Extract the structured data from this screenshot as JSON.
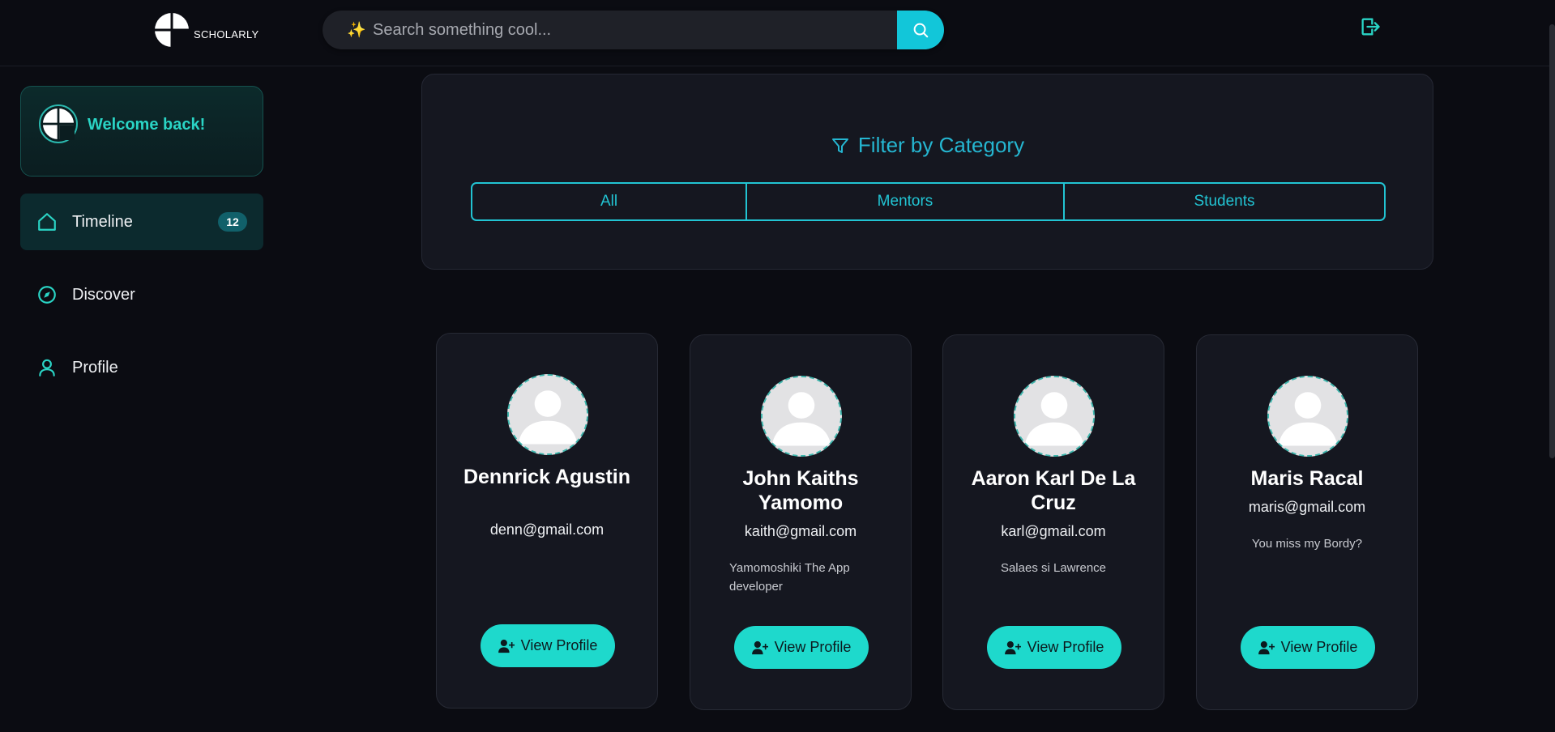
{
  "header": {
    "logo_text": "SCHOLARLY",
    "search_placeholder": "Search something cool...",
    "search_icon": "search-icon",
    "logout_icon": "logout-icon"
  },
  "sidebar": {
    "welcome_text": "Welcome back!",
    "items": [
      {
        "label": "Timeline",
        "icon": "home-icon",
        "badge": "12",
        "active": true
      },
      {
        "label": "Discover",
        "icon": "compass-icon"
      },
      {
        "label": "Profile",
        "icon": "user-icon"
      }
    ]
  },
  "filter": {
    "title": "Filter by Category",
    "options": [
      "All",
      "Mentors",
      "Students"
    ]
  },
  "users": [
    {
      "name": "Dennrick Agustin",
      "email": "denn@gmail.com",
      "bio": "",
      "button": "View Profile"
    },
    {
      "name": "John Kaiths Yamomo",
      "email": "kaith@gmail.com",
      "bio": "Yamomoshiki The App developer",
      "button": "View Profile"
    },
    {
      "name": "Aaron Karl De La Cruz",
      "email": "karl@gmail.com",
      "bio": "Salaes si Lawrence",
      "button": "View Profile"
    },
    {
      "name": "Maris Racal",
      "email": "maris@gmail.com",
      "bio": "You miss my Bordy?",
      "button": "View Profile"
    }
  ],
  "colors": {
    "accent": "#1ed9cc",
    "accent_blue": "#22c4d3",
    "background": "#0b0c12",
    "card": "#151720"
  }
}
